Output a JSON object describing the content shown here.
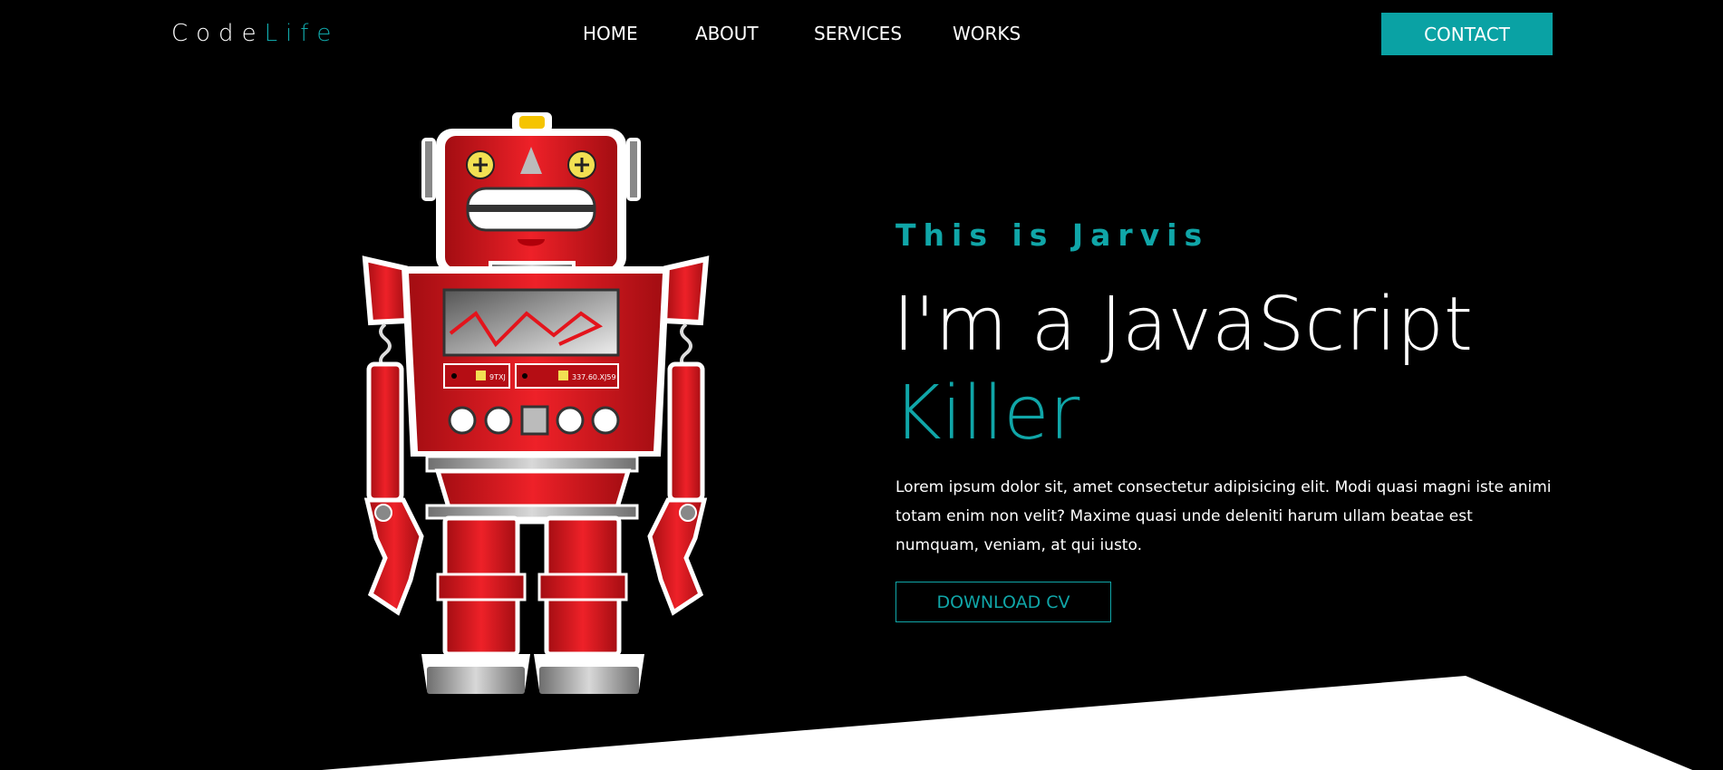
{
  "brand": {
    "part1": "Code",
    "part2": "Life"
  },
  "nav": {
    "items": [
      "HOME",
      "ABOUT",
      "SERVICES",
      "WORKS"
    ],
    "contact": "CONTACT"
  },
  "hero": {
    "tagline": "This is Jarvis",
    "headline_line1": "I'm a JavaScript",
    "headline_line2": "Killer",
    "description": "Lorem ipsum dolor sit, amet consectetur adipisicing elit. Modi quasi magni iste animi totam enim non velit? Maxime quasi unde deleniti harum ullam beatae est numquam, veniam, at qui iusto.",
    "button": "DOWNLOAD CV"
  },
  "robot": {
    "panel_left": "9TXJ",
    "panel_right": "337.60.XJ59"
  },
  "colors": {
    "accent": "#10a6a8",
    "background": "#000000",
    "robot": "#e31b23"
  }
}
